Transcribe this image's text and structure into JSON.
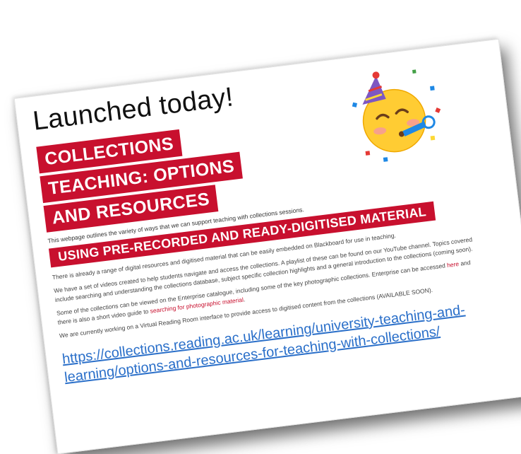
{
  "slide": {
    "headline": "Launched today!",
    "banner_lines": [
      "COLLECTIONS",
      "TEACHING: OPTIONS",
      "AND RESOURCES"
    ],
    "intro": "This webpage outlines the variety of ways that we can support teaching with collections sessions.",
    "subbanner": "USING PRE-RECORDED AND READY-DIGITISED MATERIAL",
    "para1": "There is already a range of digital resources and digitised material that can be easily embedded on Blackboard for use in teaching.",
    "para2": "We have a set of videos created to help students navigate and access the collections. A playlist of these can be found on our YouTube channel. Topics covered include searching and understanding the collections database, subject specific collection highlights and a general introduction to the collections (coming soon).",
    "para3_a": "Some of the collections can be viewed on the Enterprise catalogue, including some of the key photographic collections. Enterprise can be accessed ",
    "para3_link1": "here",
    "para3_b": " and there is also a short video guide to ",
    "para3_link2": "searching for photographic material",
    "para3_c": ".",
    "para4": "We are currently working on a Virtual Reading Room interface to provide access to digitised content from the collections (AVAILABLE SOON).",
    "url": "https://collections.reading.ac.uk/learning/university-teaching-and-learning/options-and-resources-for-teaching-with-collections/"
  },
  "icons": {
    "emoji": "partying-face-icon"
  },
  "colors": {
    "brand_red": "#c8102e",
    "link_blue": "#2a6fc9"
  }
}
